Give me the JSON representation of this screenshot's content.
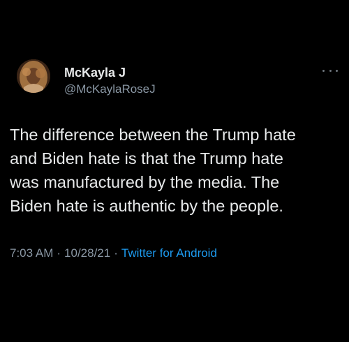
{
  "user": {
    "display_name": "McKayla J",
    "handle": "@McKaylaRoseJ"
  },
  "tweet": {
    "text": "The difference between the Trump hate\nand Biden hate is that the Trump hate\nwas manufactured by the media. The\nBiden hate is authentic by the people.",
    "time": "7:03 AM",
    "date": "10/28/21",
    "source": "Twitter for Android",
    "separator": "·"
  },
  "icons": {
    "more": "more-dots-icon"
  },
  "colors": {
    "background": "#000000",
    "text": "#e7e9ea",
    "secondary": "#8b98a5",
    "link": "#1d9bf0"
  }
}
